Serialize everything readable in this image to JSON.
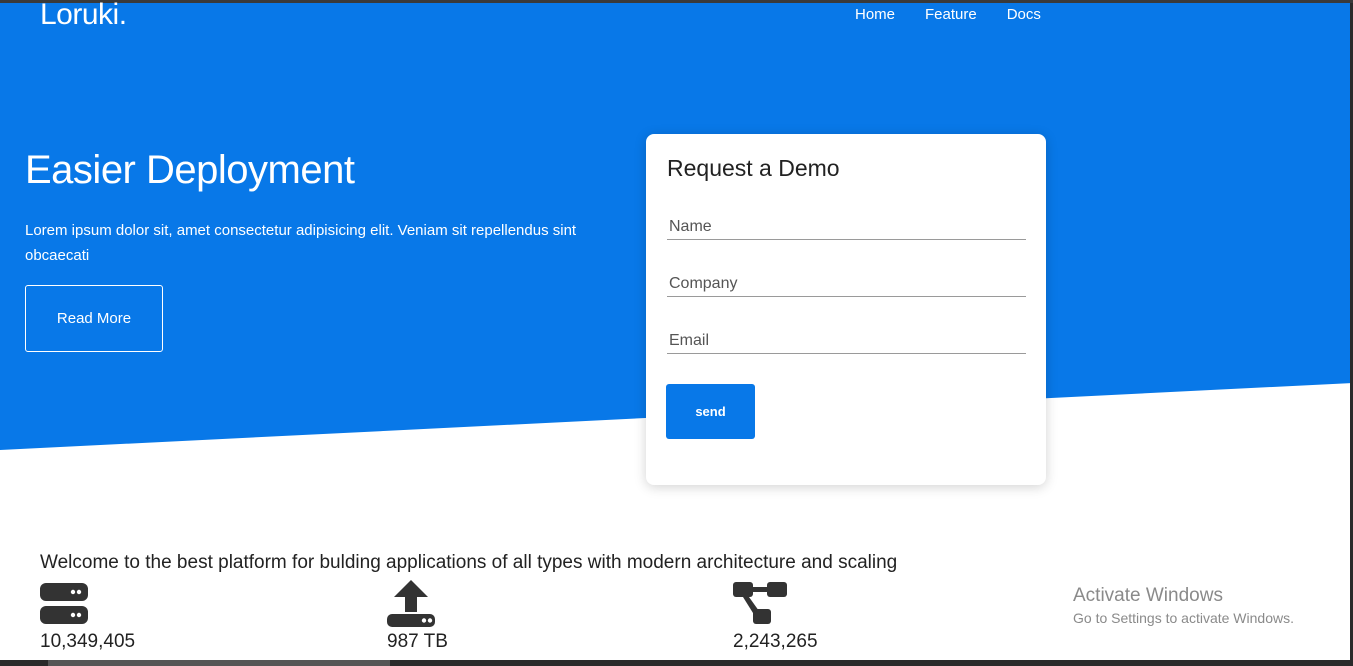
{
  "colors": {
    "brand_blue": "#0878e8",
    "white": "#ffffff",
    "text": "#222222",
    "watermark": "#8a8a8a"
  },
  "brand": {
    "logo": "Loruki."
  },
  "nav": {
    "items": [
      {
        "label": "Home"
      },
      {
        "label": "Feature"
      },
      {
        "label": "Docs"
      }
    ]
  },
  "hero": {
    "title": "Easier Deployment",
    "text": "Lorem ipsum dolor sit, amet consectetur adipisicing elit. Veniam sit repellendus sint obcaecati",
    "button": "Read More"
  },
  "demo_form": {
    "title": "Request a Demo",
    "fields": [
      {
        "placeholder": "Name",
        "value": ""
      },
      {
        "placeholder": "Company",
        "value": ""
      },
      {
        "placeholder": "Email",
        "value": ""
      }
    ],
    "submit": "send"
  },
  "stats": {
    "heading": "Welcome to the best platform for bulding applications of all types with modern architecture and scaling",
    "items": [
      {
        "icon": "server-icon",
        "value": "10,349,405"
      },
      {
        "icon": "upload-icon",
        "value": "987 TB"
      },
      {
        "icon": "network-icon",
        "value": "2,243,265"
      }
    ]
  },
  "watermark": {
    "title": "Activate Windows",
    "subtitle": "Go to Settings to activate Windows."
  }
}
